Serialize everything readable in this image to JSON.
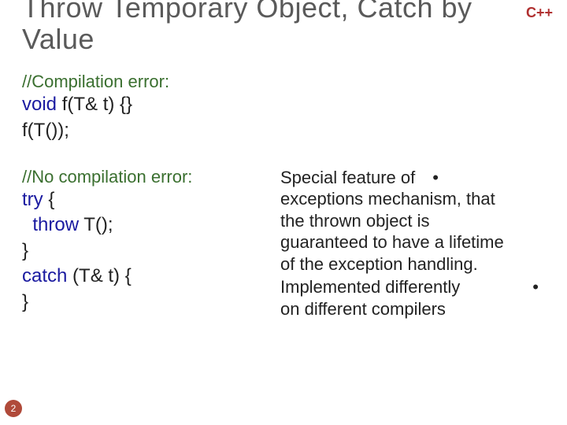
{
  "badge": "C++",
  "title": "Throw Temporary Object, Catch by Value",
  "section1": {
    "comment": "//Compilation error:",
    "kw_void": "void",
    "line1_rest": " f(T& t) {}",
    "line2": "f(T());"
  },
  "section2": {
    "comment": "//No compilation error:",
    "kw_try": "try",
    "try_rest": " {",
    "kw_throw": "throw",
    "throw_rest": " T();",
    "close1": "}",
    "kw_catch": "catch",
    "catch_rest": " (T& t) {",
    "close2": "}"
  },
  "bullets": {
    "b1_lead": "Special feature of",
    "b1_rest": "exceptions mechanism, that the thrown object is guaranteed to have a lifetime of the exception handling.",
    "b2_lead": "Implemented differently",
    "b2_rest": " on different compilers",
    "dot": "•"
  },
  "slide_number": "2"
}
